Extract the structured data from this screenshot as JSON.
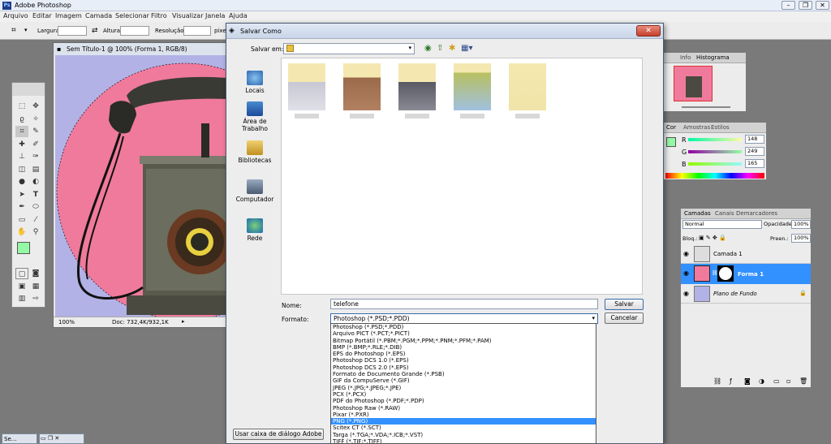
{
  "app": {
    "title": "Adobe Photoshop",
    "logo": "Ps"
  },
  "menu": [
    "Arquivo",
    "Editar",
    "Imagem",
    "Camada",
    "Selecionar",
    "Filtro",
    "Visualizar",
    "Janela",
    "Ajuda"
  ],
  "options_bar": {
    "width_label": "Largura:",
    "height_label": "Altura:",
    "resolution_label": "Resolução:",
    "unit": "pixe"
  },
  "document": {
    "title": "Sem Título-1 @ 100% (Forma 1, RGB/8)",
    "zoom": "100%",
    "doc_info": "Doc: 732,4K/932,1K"
  },
  "navigator": {
    "tabs": [
      "Info",
      "Histograma"
    ]
  },
  "color_panel": {
    "tabs": [
      "Cor",
      "Amostras",
      "Estilos"
    ],
    "channels": [
      {
        "label": "R",
        "value": "148"
      },
      {
        "label": "G",
        "value": "249"
      },
      {
        "label": "B",
        "value": "165"
      }
    ]
  },
  "layers_panel": {
    "tabs": [
      "Camadas",
      "Canais",
      "Demarcadores"
    ],
    "blend_mode": "Normal",
    "opacity_label": "Opacidade:",
    "opacity_value": "100%",
    "lock_label": "Bloq.:",
    "fill_label": "Preen.:",
    "fill_value": "100%",
    "layers": [
      {
        "name": "Camada 1",
        "selected": false
      },
      {
        "name": "Forma 1",
        "selected": true
      },
      {
        "name": "Plano de Fundo",
        "selected": false
      }
    ]
  },
  "dialog": {
    "title": "Salvar Como",
    "save_in_label": "Salvar em:",
    "places": [
      "Locais",
      "Área de Trabalho",
      "Bibliotecas",
      "Computador",
      "Rede"
    ],
    "name_label": "Nome:",
    "name_value": "telefone",
    "format_label": "Formato:",
    "format_value": "Photoshop (*.PSD;*.PDD)",
    "save_button": "Salvar",
    "cancel_button": "Cancelar",
    "adobe_dialog_button": "Usar caixa de diálogo Adobe",
    "format_options": [
      "Photoshop (*.PSD;*.PDD)",
      "Arquivo PICT (*.PCT;*.PICT)",
      "Bitmap Portátil (*.PBM;*.PGM;*.PPM;*.PNM;*.PFM;*.PAM)",
      "BMP (*.BMP;*.RLE;*.DIB)",
      "EPS do Photoshop (*.EPS)",
      "Photoshop DCS 1.0 (*.EPS)",
      "Photoshop DCS 2.0 (*.EPS)",
      "Formato de Documento Grande (*.PSB)",
      "GIF da CompuServe (*.GIF)",
      "JPEG (*.JPG;*.JPEG;*.JPE)",
      "PCX (*.PCX)",
      "PDF do Photoshop (*.PDF;*.PDP)",
      "Photoshop Raw (*.RAW)",
      "Pixar (*.PXR)",
      "PNG (*.PNG)",
      "Scitex CT (*.SCT)",
      "Targa (*.TGA;*.VDA;*.ICB;*.VST)",
      "TIFF (*.TIF;*.TIFF)"
    ],
    "selected_format_index": 14
  },
  "taskbar": {
    "item": "Se..."
  },
  "colors": {
    "foreground": "#94f9a5",
    "canvas_bg": "#b2b2e6",
    "circle": "#f07a9c",
    "selection": "#3390ff"
  }
}
